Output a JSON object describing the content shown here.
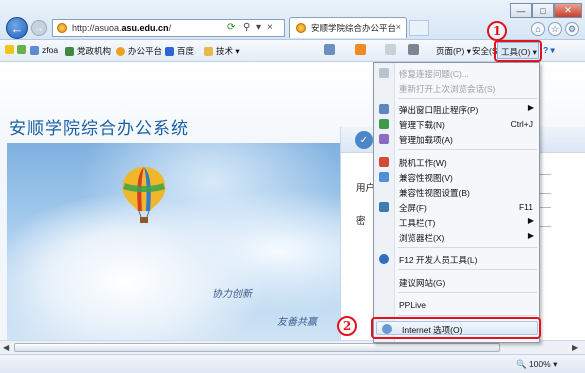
{
  "browser": {
    "address_url": "http://asuoa.",
    "address_host": "asu.edu.cn",
    "address_tail": "/",
    "tab_title": "安顺学院综合办公平台"
  },
  "favorites": [
    {
      "label": "zfoa",
      "icon": "zfoa-icon"
    },
    {
      "label": "党政机构",
      "icon": "party-icon"
    },
    {
      "label": "办公平台",
      "icon": "office-icon"
    },
    {
      "label": "百度",
      "icon": "baidu-icon"
    },
    {
      "label": "技术 ▾",
      "icon": "tech-folder-icon"
    }
  ],
  "command_bar": {
    "page": "页面(P) ▾",
    "safety": "安全(S) ▾",
    "tools": "工具(O) ▾",
    "help": "? ▾"
  },
  "page": {
    "system_title": "安顺学院综合办公系统",
    "slogan_1": "协力创新",
    "slogan_2": "友善共赢",
    "username_label": "用户",
    "password_label": "密"
  },
  "tools_menu": [
    {
      "label": "修复连接问题(C)...",
      "disabled": true,
      "icon": "repair-icon"
    },
    {
      "label": "重新打开上次浏览会话(S)",
      "disabled": true
    },
    {
      "sep": true
    },
    {
      "label": "弹出窗口阻止程序(P)",
      "submenu": true,
      "icon": "popup-blocker-icon"
    },
    {
      "label": "管理下载(N)",
      "shortcut": "Ctrl+J",
      "icon": "downloads-icon"
    },
    {
      "label": "管理加载项(A)",
      "icon": "addons-icon"
    },
    {
      "sep": true
    },
    {
      "label": "脱机工作(W)",
      "icon": "offline-icon"
    },
    {
      "label": "兼容性视图(V)",
      "icon": "compat-view-icon"
    },
    {
      "label": "兼容性视图设置(B)"
    },
    {
      "label": "全屏(F)",
      "shortcut": "F11",
      "icon": "fullscreen-icon"
    },
    {
      "label": "工具栏(T)",
      "submenu": true
    },
    {
      "label": "浏览器栏(X)",
      "submenu": true
    },
    {
      "sep": true
    },
    {
      "label": "F12 开发人员工具(L)",
      "icon": "devtools-icon"
    },
    {
      "sep": true
    },
    {
      "label": "建议网站(G)"
    },
    {
      "sep": true
    },
    {
      "label": "PPLive"
    },
    {
      "sep": true
    },
    {
      "label": "Internet 选项(O)",
      "icon": "internet-options-icon",
      "highlighted": true
    }
  ],
  "annotations": {
    "step1": "1",
    "step2": "2"
  },
  "status": {
    "zoom": "100%"
  },
  "colors": {
    "accent": "#1b5fa5",
    "annotation_red": "#e0141e"
  }
}
